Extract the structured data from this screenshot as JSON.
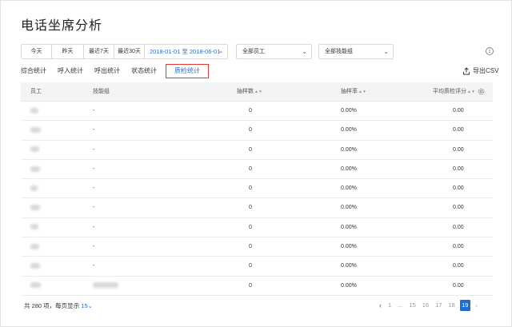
{
  "page": {
    "title": "电话坐席分析"
  },
  "filters": {
    "quick_ranges": [
      "今天",
      "昨天",
      "最近7天",
      "最近30天"
    ],
    "date_start": "2018-01-01",
    "date_sep": "至",
    "date_end": "2018-06-01",
    "employee_select": "全部员工",
    "group_select": "全部技能组"
  },
  "tabs": [
    "综合统计",
    "呼入统计",
    "呼出统计",
    "状态统计",
    "质检统计"
  ],
  "active_tab": "质检统计",
  "export_label": "导出CSV",
  "table": {
    "columns": [
      "员工",
      "技能组",
      "抽样数",
      "抽样率",
      "平均质检评分"
    ],
    "rows": [
      {
        "group": "-",
        "samples": "0",
        "rate": "0.00%",
        "score": "0.00"
      },
      {
        "group": "-",
        "samples": "0",
        "rate": "0.00%",
        "score": "0.00"
      },
      {
        "group": "-",
        "samples": "0",
        "rate": "0.00%",
        "score": "0.00"
      },
      {
        "group": "-",
        "samples": "0",
        "rate": "0.00%",
        "score": "0.00"
      },
      {
        "group": "-",
        "samples": "0",
        "rate": "0.00%",
        "score": "0.00"
      },
      {
        "group": "-",
        "samples": "0",
        "rate": "0.00%",
        "score": "0.00"
      },
      {
        "group": "-",
        "samples": "0",
        "rate": "0.00%",
        "score": "0.00"
      },
      {
        "group": "-",
        "samples": "0",
        "rate": "0.00%",
        "score": "0.00"
      },
      {
        "group": "-",
        "samples": "0",
        "rate": "0.00%",
        "score": "0.00"
      },
      {
        "group": "",
        "samples": "0",
        "rate": "0.00%",
        "score": "0.00"
      }
    ]
  },
  "footer": {
    "total_text": "共 280 项，每页显示",
    "page_size": "15"
  },
  "pagination": {
    "pages": [
      "1",
      "...",
      "15",
      "16",
      "17",
      "18",
      "19"
    ],
    "current": "19"
  },
  "colors": {
    "accent": "#1f6fd1",
    "highlight_box": "#e53935"
  }
}
